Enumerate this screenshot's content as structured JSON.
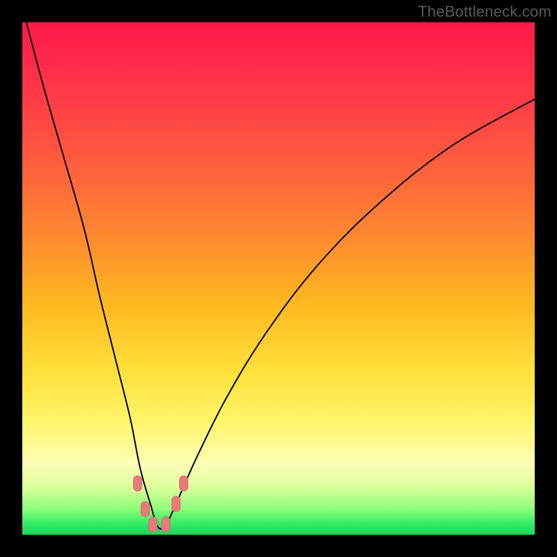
{
  "watermark": "TheBottleneck.com",
  "colors": {
    "page_bg": "#000000",
    "curve": "#000000",
    "marker": "#e77a7a",
    "gradient_top": "#ff1a4b",
    "gradient_bottom": "#1ed65a"
  },
  "chart_data": {
    "type": "line",
    "title": "",
    "xlabel": "",
    "ylabel": "",
    "xlim": [
      0,
      100
    ],
    "ylim": [
      0,
      100
    ],
    "note": "V-shaped bottleneck curve on a vertical heat gradient. y≈100 means high bottleneck (top, red); y≈0 means low (bottom, green). x-axis is an unlabeled component-ratio scale. Values estimated from pixel positions.",
    "series": [
      {
        "name": "bottleneck-curve",
        "x": [
          0,
          4,
          8,
          12,
          15,
          18,
          21,
          23,
          25,
          26.5,
          28,
          30,
          34,
          40,
          48,
          58,
          70,
          84,
          100
        ],
        "y": [
          103,
          88,
          74,
          60,
          47,
          35,
          23,
          13,
          6,
          1.5,
          2,
          6,
          15,
          27,
          40,
          53,
          65,
          76,
          85
        ]
      }
    ],
    "markers": [
      {
        "x": 22.5,
        "y": 10
      },
      {
        "x": 24.0,
        "y": 5
      },
      {
        "x": 25.5,
        "y": 2
      },
      {
        "x": 28.0,
        "y": 2
      },
      {
        "x": 30.0,
        "y": 6
      },
      {
        "x": 31.5,
        "y": 10
      }
    ]
  }
}
